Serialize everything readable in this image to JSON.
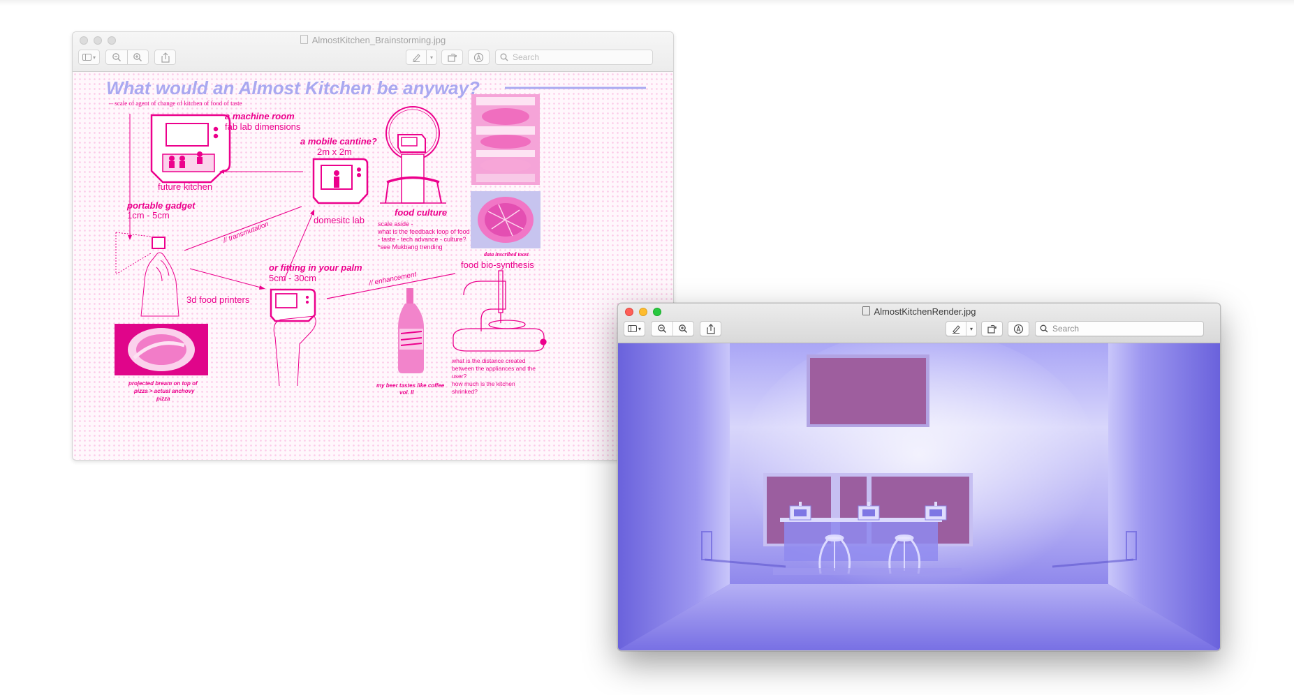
{
  "window1": {
    "title": "AlmostKitchen_Brainstorming.jpg",
    "search_placeholder": "Search",
    "poster": {
      "headline": "What would an Almost Kitchen be anyway?",
      "subline": "-- scale of agent of change of kitchen of food of taste",
      "machine_room": "a machine room",
      "machine_room_sub": "fab lab dimensions",
      "future_kitchen": "future kitchen",
      "mobile_cantine": "a mobile cantine?",
      "mobile_cantine_sub": "2m x 2m",
      "domestic_lab": "domesitc lab",
      "portable_gadget": "portable gadget",
      "portable_gadget_sub": "1cm - 5cm",
      "transmutation": "// transmutation",
      "food_culture": "food culture",
      "food_culture_notes": [
        "scale aside -",
        "what is the feedback loop of food",
        "- taste - tech advance - culture?",
        "*see Mukbang trending"
      ],
      "data_toast": "data inscribed toast",
      "fitting_palm": "or fitting in your palm",
      "fitting_palm_sub": "5cm - 30cm",
      "printers_3d": "3d food printers",
      "enhancement": "// enhancement",
      "bio_synthesis": "food bio-synthesis",
      "pizza_caption": [
        "projected bream on top of",
        "pizza > actual anchovy",
        "pizza"
      ],
      "beer_caption": [
        "my beer tastes like coffee",
        "vol. II"
      ],
      "distance_notes": [
        "what is the distance created",
        "between the appliances and the",
        "user?",
        "how much is the kitchen",
        "shrinked?"
      ]
    }
  },
  "window2": {
    "title": "AlmostKitchenRender.jpg",
    "search_placeholder": "Search"
  },
  "colors": {
    "magenta": "#ec008c",
    "lavender": "#a9a8f0",
    "render_blue": "#7a72e6"
  }
}
